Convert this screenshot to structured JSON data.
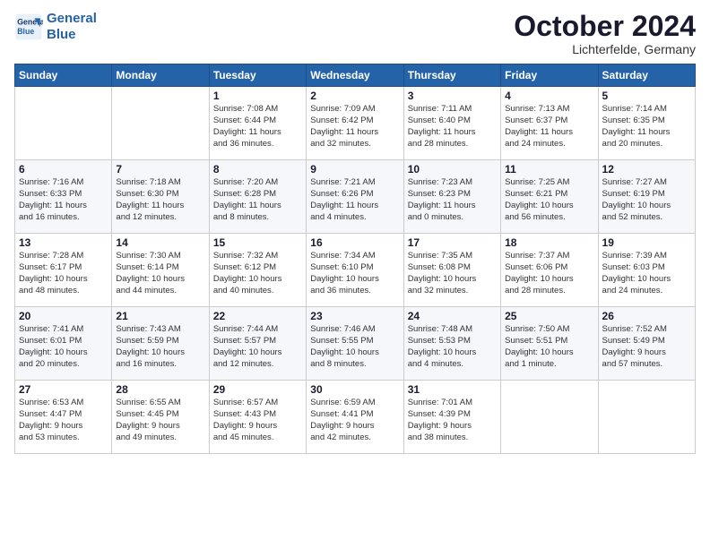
{
  "header": {
    "logo_line1": "General",
    "logo_line2": "Blue",
    "month_title": "October 2024",
    "location": "Lichterfelde, Germany"
  },
  "weekdays": [
    "Sunday",
    "Monday",
    "Tuesday",
    "Wednesday",
    "Thursday",
    "Friday",
    "Saturday"
  ],
  "weeks": [
    [
      {
        "day": "",
        "info": ""
      },
      {
        "day": "",
        "info": ""
      },
      {
        "day": "1",
        "info": "Sunrise: 7:08 AM\nSunset: 6:44 PM\nDaylight: 11 hours\nand 36 minutes."
      },
      {
        "day": "2",
        "info": "Sunrise: 7:09 AM\nSunset: 6:42 PM\nDaylight: 11 hours\nand 32 minutes."
      },
      {
        "day": "3",
        "info": "Sunrise: 7:11 AM\nSunset: 6:40 PM\nDaylight: 11 hours\nand 28 minutes."
      },
      {
        "day": "4",
        "info": "Sunrise: 7:13 AM\nSunset: 6:37 PM\nDaylight: 11 hours\nand 24 minutes."
      },
      {
        "day": "5",
        "info": "Sunrise: 7:14 AM\nSunset: 6:35 PM\nDaylight: 11 hours\nand 20 minutes."
      }
    ],
    [
      {
        "day": "6",
        "info": "Sunrise: 7:16 AM\nSunset: 6:33 PM\nDaylight: 11 hours\nand 16 minutes."
      },
      {
        "day": "7",
        "info": "Sunrise: 7:18 AM\nSunset: 6:30 PM\nDaylight: 11 hours\nand 12 minutes."
      },
      {
        "day": "8",
        "info": "Sunrise: 7:20 AM\nSunset: 6:28 PM\nDaylight: 11 hours\nand 8 minutes."
      },
      {
        "day": "9",
        "info": "Sunrise: 7:21 AM\nSunset: 6:26 PM\nDaylight: 11 hours\nand 4 minutes."
      },
      {
        "day": "10",
        "info": "Sunrise: 7:23 AM\nSunset: 6:23 PM\nDaylight: 11 hours\nand 0 minutes."
      },
      {
        "day": "11",
        "info": "Sunrise: 7:25 AM\nSunset: 6:21 PM\nDaylight: 10 hours\nand 56 minutes."
      },
      {
        "day": "12",
        "info": "Sunrise: 7:27 AM\nSunset: 6:19 PM\nDaylight: 10 hours\nand 52 minutes."
      }
    ],
    [
      {
        "day": "13",
        "info": "Sunrise: 7:28 AM\nSunset: 6:17 PM\nDaylight: 10 hours\nand 48 minutes."
      },
      {
        "day": "14",
        "info": "Sunrise: 7:30 AM\nSunset: 6:14 PM\nDaylight: 10 hours\nand 44 minutes."
      },
      {
        "day": "15",
        "info": "Sunrise: 7:32 AM\nSunset: 6:12 PM\nDaylight: 10 hours\nand 40 minutes."
      },
      {
        "day": "16",
        "info": "Sunrise: 7:34 AM\nSunset: 6:10 PM\nDaylight: 10 hours\nand 36 minutes."
      },
      {
        "day": "17",
        "info": "Sunrise: 7:35 AM\nSunset: 6:08 PM\nDaylight: 10 hours\nand 32 minutes."
      },
      {
        "day": "18",
        "info": "Sunrise: 7:37 AM\nSunset: 6:06 PM\nDaylight: 10 hours\nand 28 minutes."
      },
      {
        "day": "19",
        "info": "Sunrise: 7:39 AM\nSunset: 6:03 PM\nDaylight: 10 hours\nand 24 minutes."
      }
    ],
    [
      {
        "day": "20",
        "info": "Sunrise: 7:41 AM\nSunset: 6:01 PM\nDaylight: 10 hours\nand 20 minutes."
      },
      {
        "day": "21",
        "info": "Sunrise: 7:43 AM\nSunset: 5:59 PM\nDaylight: 10 hours\nand 16 minutes."
      },
      {
        "day": "22",
        "info": "Sunrise: 7:44 AM\nSunset: 5:57 PM\nDaylight: 10 hours\nand 12 minutes."
      },
      {
        "day": "23",
        "info": "Sunrise: 7:46 AM\nSunset: 5:55 PM\nDaylight: 10 hours\nand 8 minutes."
      },
      {
        "day": "24",
        "info": "Sunrise: 7:48 AM\nSunset: 5:53 PM\nDaylight: 10 hours\nand 4 minutes."
      },
      {
        "day": "25",
        "info": "Sunrise: 7:50 AM\nSunset: 5:51 PM\nDaylight: 10 hours\nand 1 minute."
      },
      {
        "day": "26",
        "info": "Sunrise: 7:52 AM\nSunset: 5:49 PM\nDaylight: 9 hours\nand 57 minutes."
      }
    ],
    [
      {
        "day": "27",
        "info": "Sunrise: 6:53 AM\nSunset: 4:47 PM\nDaylight: 9 hours\nand 53 minutes."
      },
      {
        "day": "28",
        "info": "Sunrise: 6:55 AM\nSunset: 4:45 PM\nDaylight: 9 hours\nand 49 minutes."
      },
      {
        "day": "29",
        "info": "Sunrise: 6:57 AM\nSunset: 4:43 PM\nDaylight: 9 hours\nand 45 minutes."
      },
      {
        "day": "30",
        "info": "Sunrise: 6:59 AM\nSunset: 4:41 PM\nDaylight: 9 hours\nand 42 minutes."
      },
      {
        "day": "31",
        "info": "Sunrise: 7:01 AM\nSunset: 4:39 PM\nDaylight: 9 hours\nand 38 minutes."
      },
      {
        "day": "",
        "info": ""
      },
      {
        "day": "",
        "info": ""
      }
    ]
  ]
}
